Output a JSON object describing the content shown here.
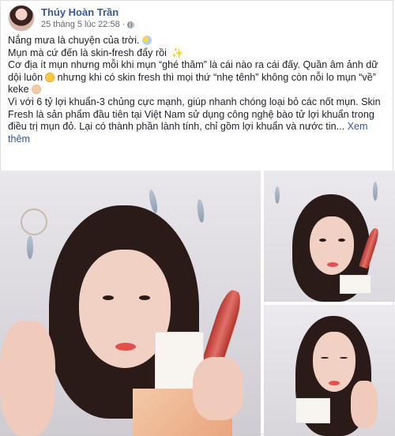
{
  "post": {
    "author": "Thúy Hoàn Trần",
    "timestamp": "25 tháng 5 lúc 22:58",
    "separator": "·",
    "lines": [
      "Nắng mưa là chuyện của trời.",
      "Mụn mà cứ đến là skin-fresh đẩy rồi",
      "Cơ địa ít mụn nhưng mỗi khi mụn “ghé thăm” là cái nào ra cái đấy. Quần âm ảnh dữ dội luôn",
      " nhưng khi có skin fresh thì mọi thứ “nhẹ tênh” không còn nỗi lo mụn “về” keke",
      "Vì với 6 tỷ lợi khuẩn-3 chủng cực mạnh, giúp nhanh chóng loại bỏ các nốt mụn. Skin Fresh là sản phẩm đầu tiên tại Việt Nam sử dụng công nghệ bào tử lợi khuẩn trong điều trị mụn đỏ. Lại có thành phần lành tính, chỉ gồm lợi khuẩn và nước tin...",
      "Xem thêm"
    ],
    "icons": {
      "cloud": "sun-behind-cloud-icon",
      "sparkle": "sparkles-icon",
      "cry": "crying-face-icon",
      "hand": "thumbs-up-icon",
      "privacy": "globe-icon"
    },
    "colors": {
      "link": "#385898",
      "meta": "#616770",
      "text": "#1d2129"
    }
  }
}
